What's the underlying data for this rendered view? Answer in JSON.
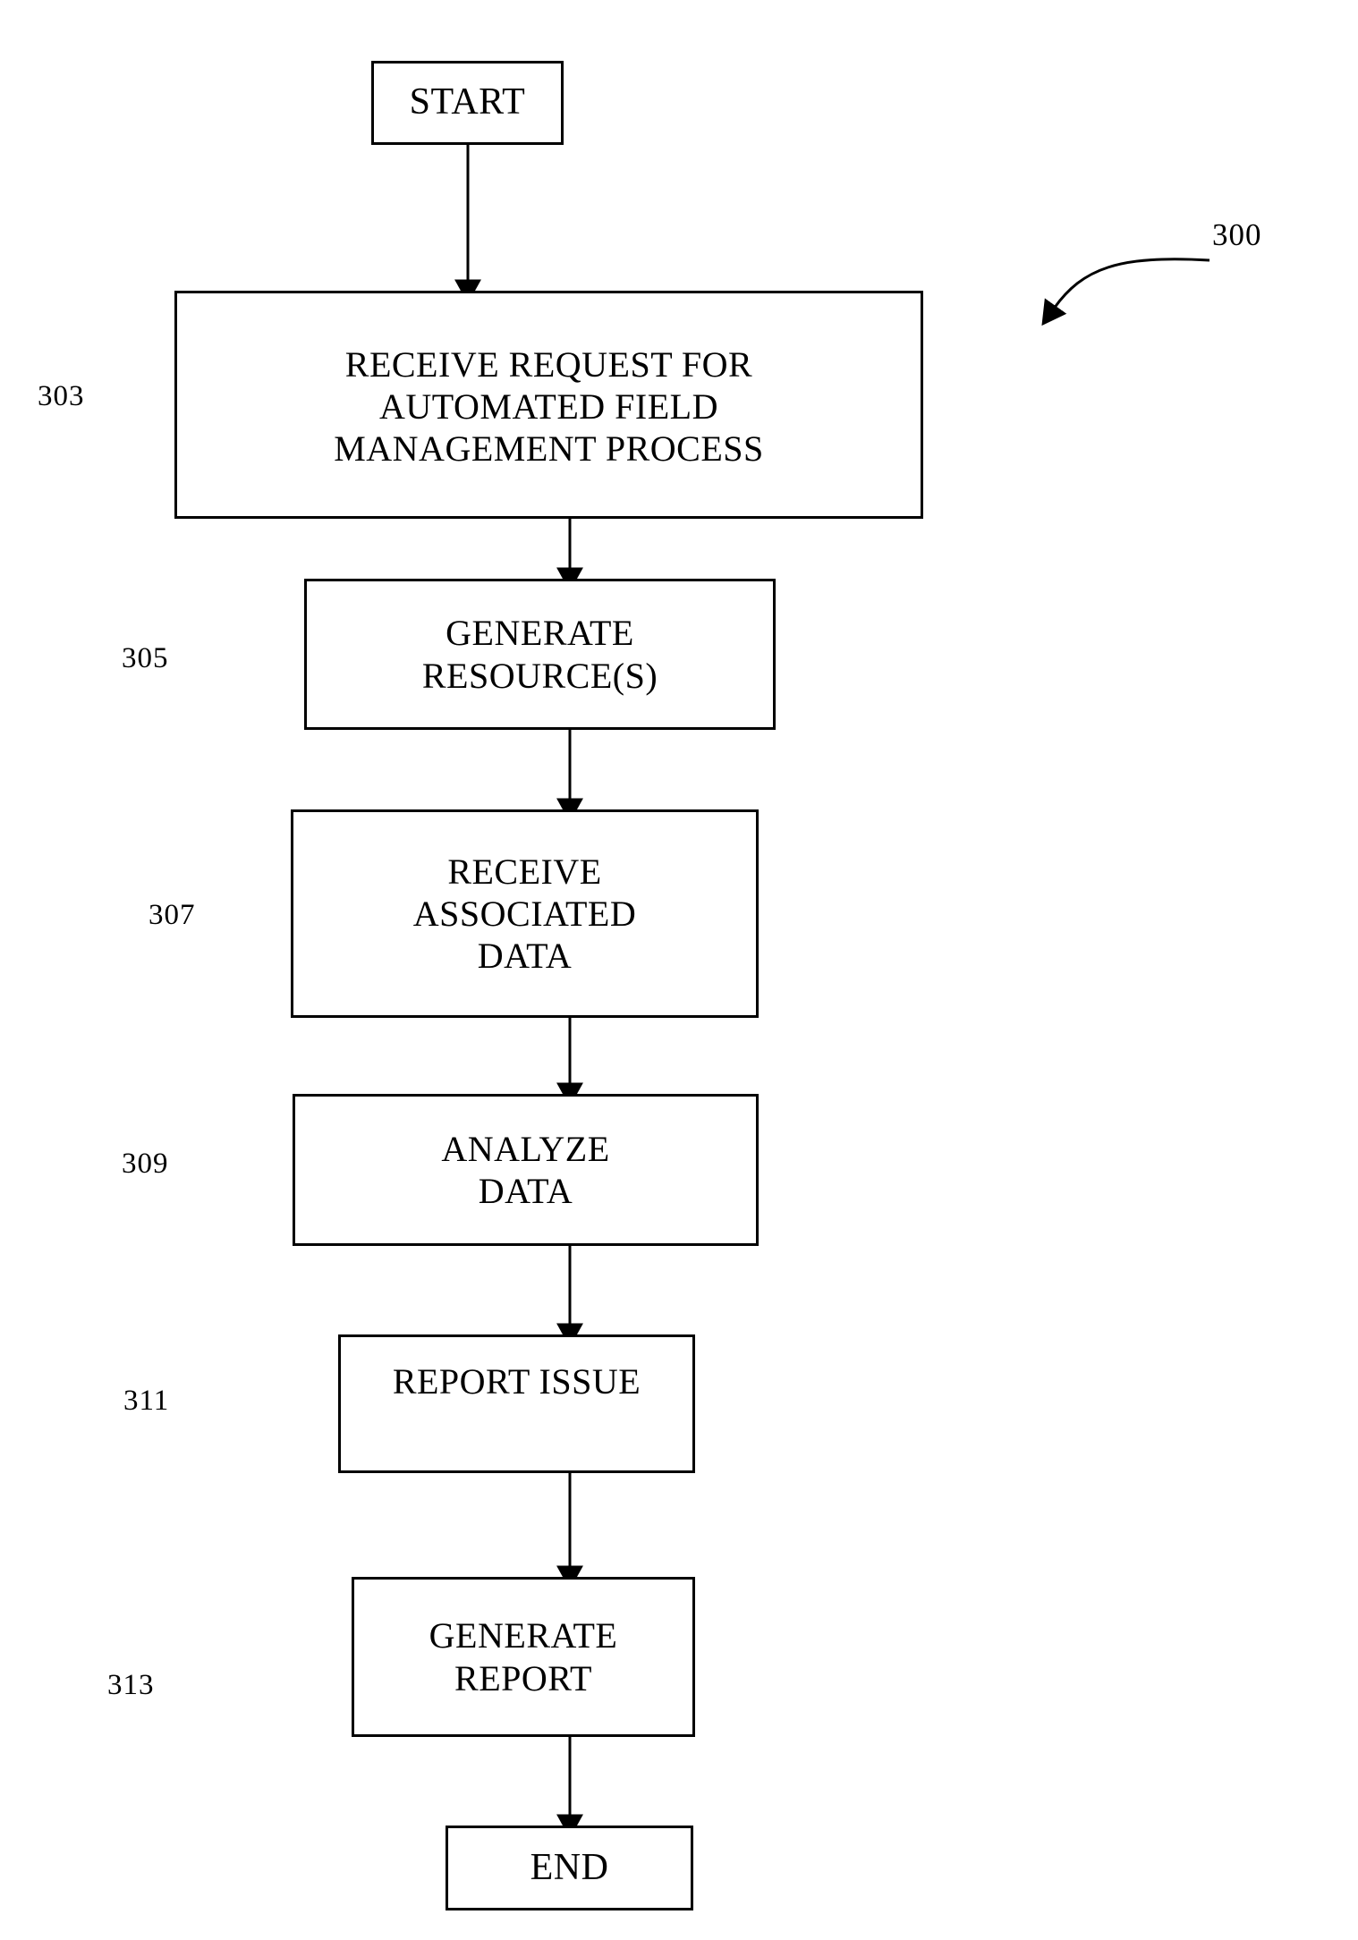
{
  "figure": {
    "reference_numeral": "300",
    "type": "process-flowchart"
  },
  "nodes": [
    {
      "id": "start",
      "ref": "",
      "lines": [
        "START"
      ]
    },
    {
      "id": "303",
      "ref": "303",
      "lines": [
        "RECEIVE REQUEST FOR",
        "AUTOMATED FIELD",
        "MANAGEMENT PROCESS"
      ]
    },
    {
      "id": "305",
      "ref": "305",
      "lines": [
        "GENERATE",
        "RESOURCE(S)"
      ]
    },
    {
      "id": "307",
      "ref": "307",
      "lines": [
        "RECEIVE",
        "ASSOCIATED",
        "DATA"
      ]
    },
    {
      "id": "309",
      "ref": "309",
      "lines": [
        "ANALYZE",
        "DATA"
      ]
    },
    {
      "id": "311",
      "ref": "311",
      "lines": [
        "REPORT ISSUE"
      ]
    },
    {
      "id": "313",
      "ref": "313",
      "lines": [
        "GENERATE",
        "REPORT"
      ]
    },
    {
      "id": "end",
      "ref": "",
      "lines": [
        "END"
      ]
    }
  ],
  "text": {
    "start": "START",
    "box_303_line1": "RECEIVE REQUEST FOR",
    "box_303_line2": "AUTOMATED FIELD",
    "box_303_line3": "MANAGEMENT PROCESS",
    "box_305_line1": "GENERATE",
    "box_305_line2": "RESOURCE(S)",
    "box_307_line1": "RECEIVE",
    "box_307_line2": "ASSOCIATED",
    "box_307_line3": "DATA",
    "box_309_line1": "ANALYZE",
    "box_309_line2": "DATA",
    "box_311_line1": "REPORT ISSUE",
    "box_313_line1": "GENERATE",
    "box_313_line2": "REPORT",
    "end": "END"
  },
  "reference_numerals": {
    "n303": "303",
    "n305": "305",
    "n307": "307",
    "n309": "309",
    "n311": "311",
    "n313": "313",
    "n300": "300"
  },
  "colors": {
    "stroke": "#000000",
    "fill": "#ffffff",
    "text": "#000000"
  },
  "connectors": [
    {
      "from": "start",
      "to": "303"
    },
    {
      "from": "303",
      "to": "305"
    },
    {
      "from": "305",
      "to": "307"
    },
    {
      "from": "307",
      "to": "309"
    },
    {
      "from": "309",
      "to": "311"
    },
    {
      "from": "311",
      "to": "313"
    },
    {
      "from": "313",
      "to": "end"
    }
  ]
}
